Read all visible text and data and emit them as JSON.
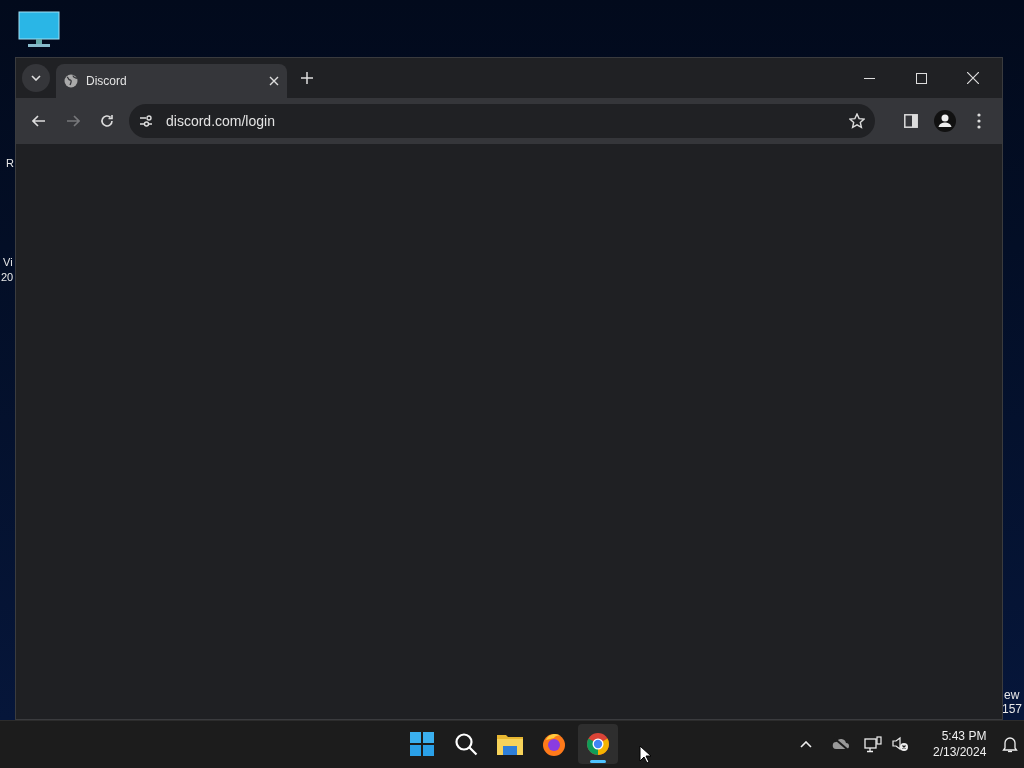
{
  "desktop": {
    "left_fragments": [
      {
        "text": "R"
      },
      {
        "text": "Vi"
      },
      {
        "text": "20"
      }
    ],
    "right_fragments": [
      {
        "text": "ew"
      },
      {
        "text": "157"
      }
    ]
  },
  "browser": {
    "tabs": [
      {
        "title": "Discord",
        "selected": true
      }
    ],
    "address": "discord.com/login"
  },
  "taskbar": {
    "apps": [
      {
        "kind": "start",
        "selected": false
      },
      {
        "kind": "search",
        "selected": false
      },
      {
        "kind": "files",
        "selected": false
      },
      {
        "kind": "firefox",
        "selected": false
      },
      {
        "kind": "chrome",
        "selected": true
      }
    ],
    "clock": {
      "time": "5:43 PM",
      "date": "2/13/2024"
    }
  }
}
